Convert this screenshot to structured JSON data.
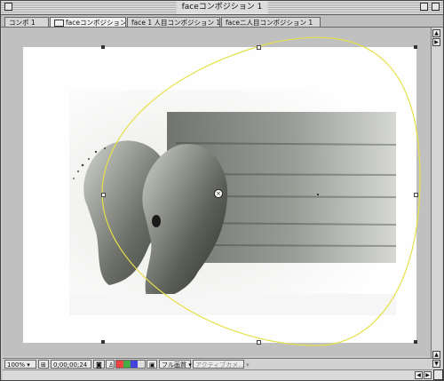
{
  "window": {
    "title": "faceコンポジション 1"
  },
  "tabs": [
    {
      "label": "コンポ 1",
      "active": false
    },
    {
      "label": "faceコンポジション 1",
      "active": true,
      "icon": "composition-icon"
    },
    {
      "label": "face 1 人目コンポジション 1",
      "active": false
    },
    {
      "label": "face二人目コンポジション 1",
      "active": false
    }
  ],
  "bottombar": {
    "zoom": "100%",
    "timecode": "0;00;00;24",
    "resolution": "フル画質",
    "camera": "アクティブカメ..."
  },
  "colors": {
    "motion_path": "#e6e04a",
    "panel": "#c8c8c8"
  }
}
